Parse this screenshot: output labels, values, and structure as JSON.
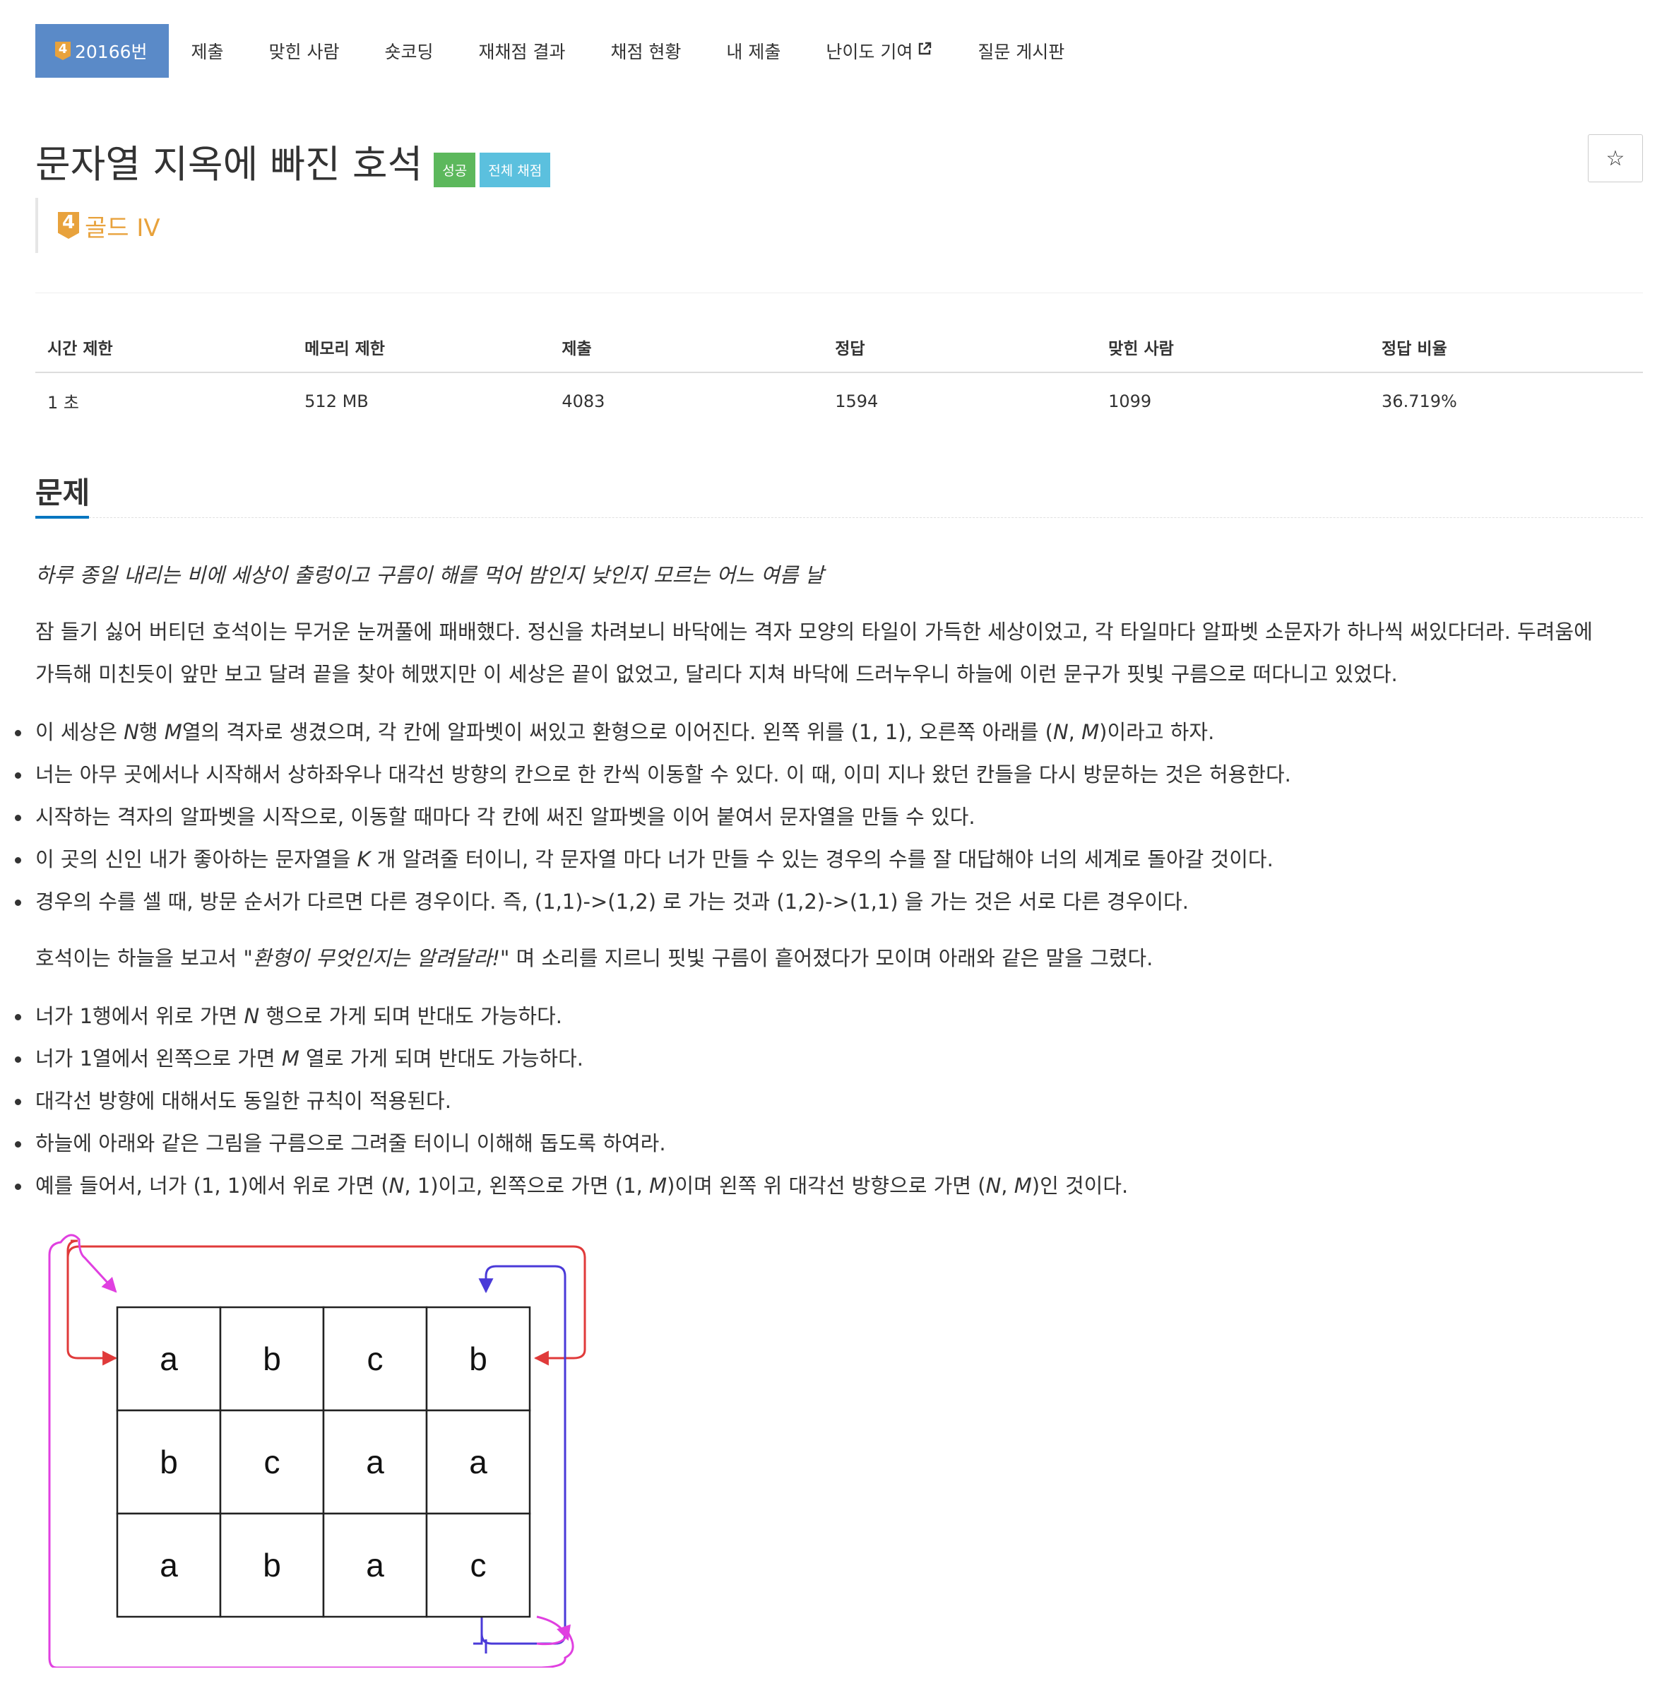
{
  "nav": {
    "items": [
      {
        "label": "20166번",
        "tier": "4"
      },
      {
        "label": "제출"
      },
      {
        "label": "맞힌 사람"
      },
      {
        "label": "숏코딩"
      },
      {
        "label": "재채점 결과"
      },
      {
        "label": "채점 현황"
      },
      {
        "label": "내 제출"
      },
      {
        "label": "난이도 기여"
      },
      {
        "label": "질문 게시판"
      }
    ]
  },
  "problem": {
    "title": "문자열 지옥에 빠진 호석",
    "labels": [
      "성공",
      "전체 채점"
    ],
    "star_icon": "☆",
    "tier_number": "4",
    "tier_name": "골드 IV"
  },
  "stats": {
    "headers": [
      "시간 제한",
      "메모리 제한",
      "제출",
      "정답",
      "맞힌 사람",
      "정답 비율"
    ],
    "values": [
      "1 초",
      "512 MB",
      "4083",
      "1594",
      "1099",
      "36.719%"
    ]
  },
  "section": {
    "title": "문제"
  },
  "body": {
    "intro_italic": "하루 종일 내리는 비에 세상이 출렁이고 구름이 해를 먹어 밤인지 낮인지 모르는 어느 여름 날",
    "para1_line1": "잠 들기 싫어 버티던 호석이는 무거운 눈꺼풀에 패배했다. 정신을 차려보니 바닥에는 격자 모양의 타일이 가득한 세상이었고, 각 타일마다 알파벳 소문자가 하나씩 써있다더라. 두려움에",
    "para1_line2": "가득해 미친듯이 앞만 보고 달려 끝을 찾아 헤맸지만 이 세상은 끝이 없었고, 달리다 지쳐 바닥에 드러누우니 하늘에 이런 문구가 핏빛 구름으로 떠다니고 있었다.",
    "list1": {
      "b1_pre": "이 세상은 ",
      "b1_n": "N",
      "b1_mid": "행 ",
      "b1_m": "M",
      "b1_post": "열의 격자로 생겼으며, 각 칸에 알파벳이 써있고 환형으로 이어진다. 왼쪽 위를 (1, 1), 오른쪽 아래를 (",
      "b1_n2": "N",
      "b1_comma": ", ",
      "b1_m2": "M",
      "b1_end": ")이라고 하자.",
      "b2": "너는 아무 곳에서나 시작해서 상하좌우나 대각선 방향의 칸으로 한 칸씩 이동할 수 있다. 이 때, 이미 지나 왔던 칸들을 다시 방문하는 것은 허용한다.",
      "b3": "시작하는 격자의 알파벳을 시작으로, 이동할 때마다 각 칸에 써진 알파벳을 이어 붙여서 문자열을 만들 수 있다.",
      "b4_pre": "이 곳의 신인 내가 좋아하는 문자열을 ",
      "b4_k": "K",
      "b4_post": " 개 알려줄 터이니, 각 문자열 마다 너가 만들 수 있는 경우의 수를 잘 대답해야 너의 세계로 돌아갈 것이다.",
      "b5": "경우의 수를 셀 때, 방문 순서가 다르면 다른 경우이다. 즉, (1,1)->(1,2) 로 가는 것과 (1,2)->(1,1) 을 가는 것은 서로 다른 경우이다."
    },
    "para2_pre": "호석이는 하늘을 보고서 ",
    "para2_italic": "\"환형이 무엇인지는 알려달라!\"",
    "para2_post": " 며 소리를 지르니 핏빛 구름이 흩어졌다가 모이며 아래와 같은 말을 그렸다.",
    "list2": {
      "b1_pre": "너가 1행에서 위로 가면 ",
      "b1_n": "N",
      "b1_post": " 행으로 가게 되며 반대도 가능하다.",
      "b2_pre": "너가 1열에서 왼쪽으로 가면 ",
      "b2_m": "M",
      "b2_post": " 열로 가게 되며 반대도 가능하다.",
      "b3": "대각선 방향에 대해서도 동일한 규칙이 적용된다.",
      "b4": "하늘에 아래와 같은 그림을 구름으로 그려줄 터이니 이해해 돕도록 하여라.",
      "b5_a": "예를 들어서, 너가 (1, 1)에서 위로 가면 (",
      "b5_n": "N",
      "b5_b": ", 1)이고, 왼쪽으로 가면 (1, ",
      "b5_m": "M",
      "b5_c": ")이며 왼쪽 위 대각선 방향으로 가면 (",
      "b5_n2": "N",
      "b5_comma": ", ",
      "b5_m2": "M",
      "b5_d": ")인 것이다."
    }
  },
  "grid": {
    "rows": [
      [
        "a",
        "b",
        "c",
        "b"
      ],
      [
        "b",
        "c",
        "a",
        "a"
      ],
      [
        "a",
        "b",
        "a",
        "c"
      ]
    ],
    "colors": {
      "red": "#e03a3a",
      "blue": "#4a3ad8",
      "magenta": "#e040e0"
    }
  },
  "colors": {
    "accent": "#5a8ac8",
    "gold": "#e8a23c",
    "success": "#5cb85c",
    "info": "#5bc0de"
  }
}
